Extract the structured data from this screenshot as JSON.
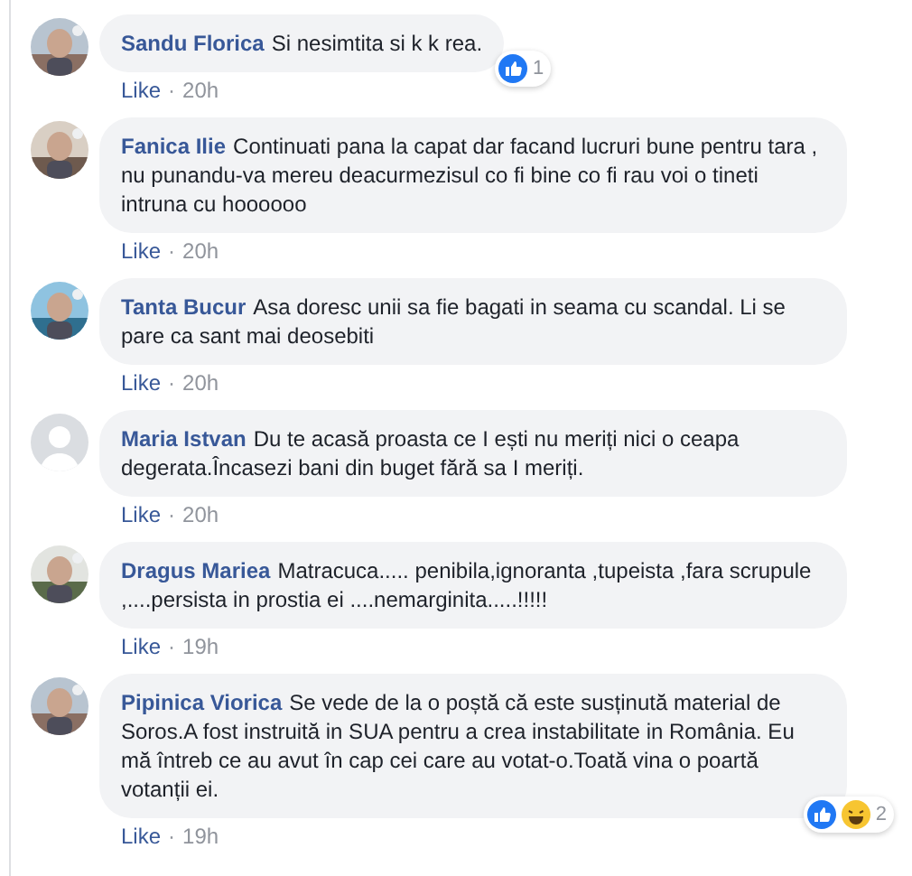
{
  "comments": [
    {
      "author": "Sandu Florica",
      "text": "Si nesimtita si k k rea.",
      "reactions": {
        "types": [
          {
            "kind": "like"
          }
        ],
        "count": "1"
      },
      "action": "Like",
      "dot": "·",
      "time": "20h"
    },
    {
      "author": "Fanica Ilie",
      "text": "Continuati pana la capat dar facand lucruri bune pentru tara , nu punandu-va mereu deacurmezisul co fi bine co fi rau voi o tineti intruna cu hoooooo",
      "action": "Like",
      "dot": "·",
      "time": "20h"
    },
    {
      "author": "Tanta Bucur",
      "text": "Asa doresc unii sa fie bagati in seama cu scandal. Li se pare ca sant mai deosebiti",
      "action": "Like",
      "dot": "·",
      "time": "20h"
    },
    {
      "author": "Maria Istvan",
      "text": "Du te acasă proasta ce I ești nu meriți nici o ceapa degerata.Încasezi bani din buget fără sa I meriți.",
      "avatar": {
        "kind": "default"
      },
      "action": "Like",
      "dot": "·",
      "time": "20h"
    },
    {
      "author": "Dragus Mariea",
      "text": "Matracuca..... penibila,ignoranta ,tupeista ,fara scrupule ,....persista in prostia ei ....nemarginita.....!!!!!",
      "action": "Like",
      "dot": "·",
      "time": "19h"
    },
    {
      "author": "Pipinica Viorica",
      "text": "Se vede de la o poștă că este susținută material de Soros.A fost instruită in SUA pentru a crea instabilitate in România. Eu mă întreb ce au avut în cap cei care au votat-o.Toată vina o poartă votanții ei.",
      "reactions": {
        "types": [
          {
            "kind": "like"
          },
          {
            "kind": "haha"
          }
        ],
        "count": "2"
      },
      "action": "Like",
      "dot": "·",
      "time": "19h"
    }
  ]
}
